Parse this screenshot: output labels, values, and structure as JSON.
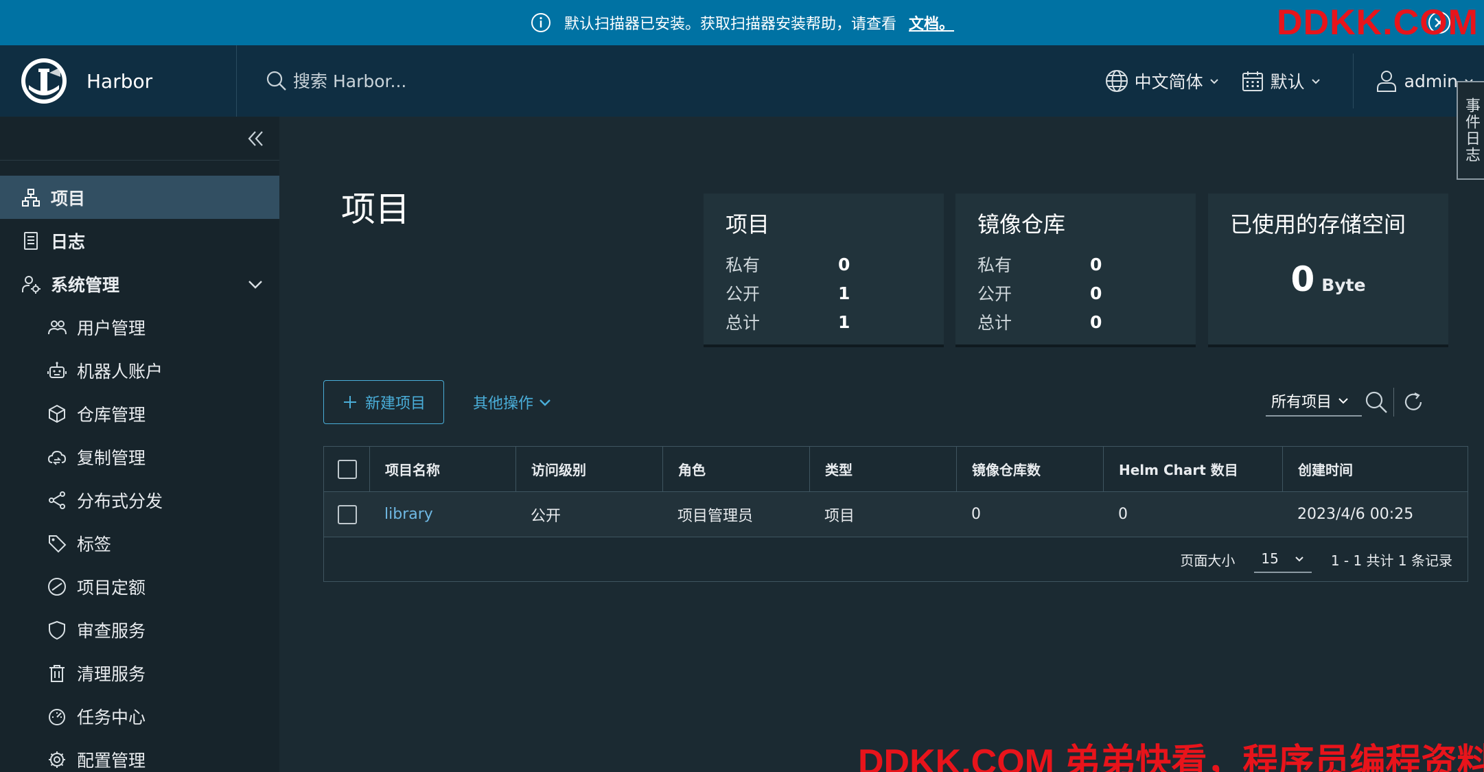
{
  "banner": {
    "message": "默认扫描器已安装。获取扫描器安装帮助，请查看",
    "link_text": "文档。"
  },
  "watermark": {
    "top": "DDKK.COM",
    "bottom": "DDKK.COM 弟弟快看，程序员编程资料站"
  },
  "header": {
    "brand_name": "Harbor",
    "search_placeholder": "搜索 Harbor...",
    "language": "中文简体",
    "datetime_format": "默认",
    "user": "admin",
    "event_log": "事件日志"
  },
  "sidebar": {
    "items": [
      {
        "label": "项目"
      },
      {
        "label": "日志"
      },
      {
        "label": "系统管理"
      },
      {
        "label": "用户管理"
      },
      {
        "label": "机器人账户"
      },
      {
        "label": "仓库管理"
      },
      {
        "label": "复制管理"
      },
      {
        "label": "分布式分发"
      },
      {
        "label": "标签"
      },
      {
        "label": "项目定额"
      },
      {
        "label": "审查服务"
      },
      {
        "label": "清理服务"
      },
      {
        "label": "任务中心"
      },
      {
        "label": "配置管理"
      }
    ]
  },
  "main": {
    "title": "项目",
    "cards": {
      "projects": {
        "title": "项目",
        "private_label": "私有",
        "private": "0",
        "public_label": "公开",
        "public": "1",
        "total_label": "总计",
        "total": "1"
      },
      "repos": {
        "title": "镜像仓库",
        "private_label": "私有",
        "private": "0",
        "public_label": "公开",
        "public": "0",
        "total_label": "总计",
        "total": "0"
      },
      "storage": {
        "title": "已使用的存储空间",
        "value": "0",
        "unit": "Byte"
      }
    },
    "toolbar": {
      "new_project": "新建项目",
      "other_actions": "其他操作",
      "filter": "所有项目"
    },
    "table": {
      "columns": [
        "项目名称",
        "访问级别",
        "角色",
        "类型",
        "镜像仓库数",
        "Helm Chart 数目",
        "创建时间"
      ],
      "rows": [
        [
          "library",
          "公开",
          "项目管理员",
          "项目",
          "0",
          "0",
          "2023/4/6 00:25"
        ]
      ]
    },
    "footer": {
      "page_size_label": "页面大小",
      "page_size": "15",
      "summary": "1 - 1 共计 1 条记录"
    }
  }
}
